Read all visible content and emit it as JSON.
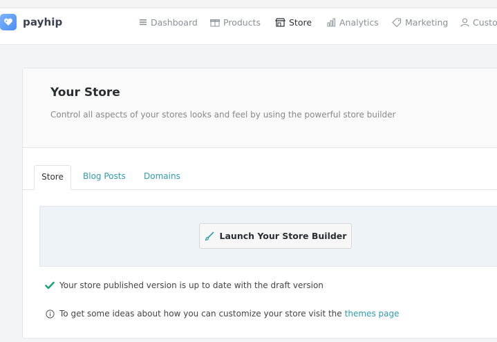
{
  "brand": {
    "name": "payhip"
  },
  "nav": [
    {
      "label": "Dashboard",
      "icon": "menu-icon",
      "active": false
    },
    {
      "label": "Products",
      "icon": "gift-icon",
      "active": false
    },
    {
      "label": "Store",
      "icon": "store-icon",
      "active": true
    },
    {
      "label": "Analytics",
      "icon": "bar-chart-icon",
      "active": false
    },
    {
      "label": "Marketing",
      "icon": "tag-icon",
      "active": false
    },
    {
      "label": "Custo",
      "icon": "user-icon",
      "active": false
    }
  ],
  "page": {
    "title": "Your Store",
    "subtitle": "Control all aspects of your stores looks and feel by using the powerful store builder"
  },
  "tabs": [
    {
      "label": "Store",
      "active": true
    },
    {
      "label": "Blog Posts",
      "active": false
    },
    {
      "label": "Domains",
      "active": false
    }
  ],
  "builder": {
    "button_label": "Launch Your Store Builder"
  },
  "messages": {
    "published": "Your store published version is up to date with the draft version",
    "tip_text": "To get some ideas about how you can customize your store visit the",
    "tip_link": "themes page"
  },
  "colors": {
    "accent": "#2f9bb0",
    "success": "#1aa37a",
    "brand_gradient_start": "#7fb3ff",
    "brand_gradient_end": "#4a8ef0"
  }
}
